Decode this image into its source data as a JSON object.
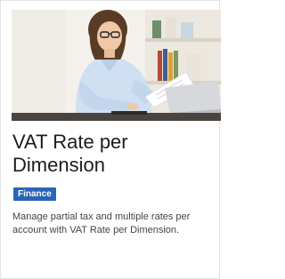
{
  "card": {
    "image_icon": "woman-with-laptop-photo",
    "title": "VAT Rate per Dimension",
    "category_badge": "Finance",
    "description": "Manage partial tax and multiple rates per account with VAT Rate per Dimension."
  },
  "colors": {
    "badge_background": "#2a64b7",
    "title_text": "#1c1c1c",
    "description_text": "#444444"
  }
}
